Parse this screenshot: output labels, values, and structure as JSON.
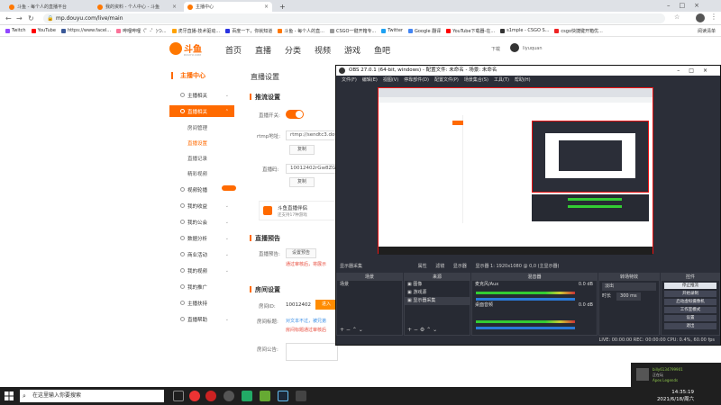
{
  "browser": {
    "tabs": [
      {
        "title": "斗鱼 - 每个人的直播平台"
      },
      {
        "title": "我的资料 - 个人中心 - 斗鱼"
      },
      {
        "title": "主播中心"
      }
    ],
    "new_tab": "+",
    "url": "mp.douyu.com/live/main",
    "bookmarks": [
      "Twitch",
      "YouTube",
      "https://www.facel...",
      "哔哩哔哩（゜-゜)つ...",
      "虎牙直播-技术驱动...",
      "百度一下，你就知道",
      "斗鱼 - 每个人的直...",
      "CSGO一键开箱专...",
      "Twitter",
      "Google 翻译",
      "YouTube下载器-在...",
      "s1mple - CSGO S...",
      "csgo快捷键开箱优..."
    ],
    "reading_list": "阅读清单"
  },
  "site": {
    "logo_text": "斗鱼",
    "logo_sub": "DOUYU.COM",
    "nav": [
      "首页",
      "直播",
      "分类",
      "视频",
      "游戏",
      "鱼吧"
    ],
    "download": "下载",
    "username": "liyuquan"
  },
  "sidebar": {
    "title": "主播中心",
    "items": [
      {
        "label": "主播相关"
      },
      {
        "label": "直播相关"
      },
      {
        "label": "房间管理"
      },
      {
        "label": "直播设置"
      },
      {
        "label": "直播记录"
      },
      {
        "label": "精彩视频"
      },
      {
        "label": "视频轮播"
      },
      {
        "label": "我的收益"
      },
      {
        "label": "我的公会"
      },
      {
        "label": "数据分析"
      },
      {
        "label": "商业活动"
      },
      {
        "label": "我的视频"
      },
      {
        "label": "我的推广"
      },
      {
        "label": "主播扶持"
      },
      {
        "label": "直播帮助"
      }
    ]
  },
  "main": {
    "title": "直播设置",
    "push_section": "推流设置",
    "live_switch_label": "直播开关:",
    "rtmp_label": "rtmp地址:",
    "rtmp_value": "rtmp://sendtc3.douyu",
    "copy": "复制",
    "code_label": "直播码:",
    "code_value": "10012402rGw8ZGQ",
    "promo_text": "斗鱼直播伴侣",
    "promo_sub": "还支持17种游戏",
    "preview_section": "直播预告",
    "preview_label": "直播预告:",
    "preview_btn": "设置预告",
    "preview_warn": "通过审核后，将展示",
    "room_section": "房间设置",
    "room_id_label": "房间ID:",
    "room_id": "10012402",
    "room_enter": "进入",
    "room_name_label": "房间标题:",
    "room_name_warn": "对文本不过，被兄弟",
    "room_name_warn2": "房间标题通过审核后",
    "room_notice_label": "房间公告:"
  },
  "obs": {
    "title": "OBS 27.0.1 (64-bit, windows) - 配置文件: 未命名 - 场景: 未命名",
    "menu": [
      "文件(F)",
      "编辑(E)",
      "视图(V)",
      "停靠部件(D)",
      "配置文件(P)",
      "场景集合(S)",
      "工具(T)",
      "帮助(H)"
    ],
    "source_bar": "显示器采集",
    "source_bar_items": [
      "属性",
      "滤镜",
      "显示器",
      "显示器 1: 1920x1080 @ 0,0 (主显示器)"
    ],
    "docks": {
      "scenes": {
        "title": "场景",
        "items": [
          "场景"
        ]
      },
      "sources": {
        "title": "来源",
        "items": [
          "图像",
          "游戏源",
          "显示器采集"
        ]
      },
      "mixer": {
        "title": "混音器",
        "channels": [
          {
            "name": "桌面音频",
            "db": "0.0 dB"
          },
          {
            "name": "麦克风/Aux",
            "db": "0.0 dB"
          }
        ]
      },
      "transitions": {
        "title": "转场特效",
        "fade": "淡出",
        "duration_label": "时长",
        "duration": "300 ms"
      },
      "controls": {
        "title": "控件",
        "buttons": [
          "停止推流",
          "开始录制",
          "启动虚拟摄像机",
          "工作室模式",
          "设置",
          "退出"
        ]
      }
    },
    "status": "LIVE: 00:00:00   REC: 00:00:00   CPU: 0.4%, 60.00 fps"
  },
  "taskbar": {
    "search_placeholder": "在这里输入你要搜索",
    "time": "14:35:19",
    "date": "2021/6/18/周六"
  },
  "notification": {
    "title": "billy6134799901",
    "line2": "正在玩",
    "line3": "Apex Legends"
  }
}
